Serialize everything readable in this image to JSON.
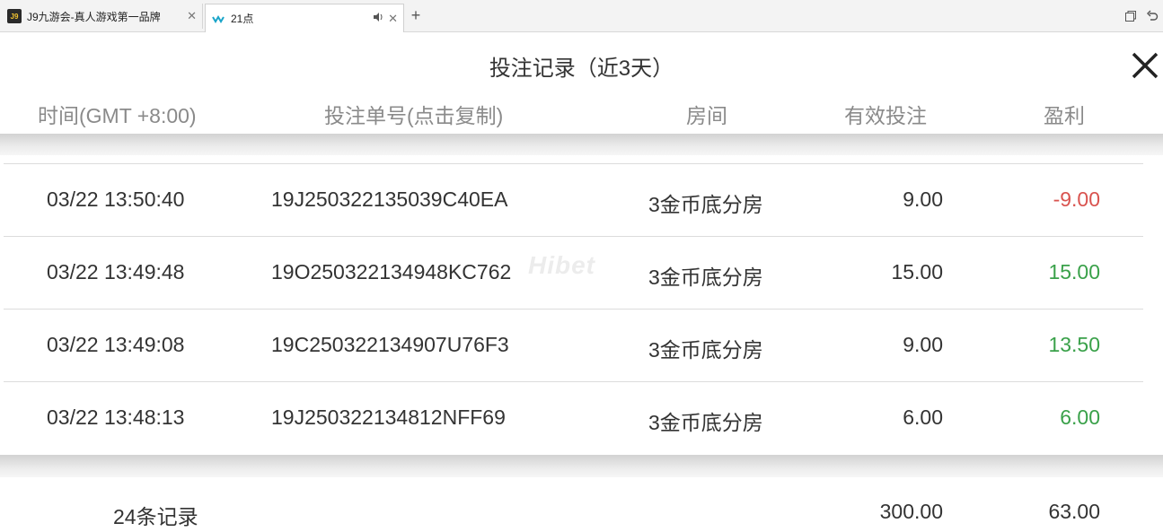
{
  "browser": {
    "tabs": [
      {
        "label": "J9九游会-真人游戏第一品牌",
        "favicon": "J9"
      },
      {
        "label": "21点"
      }
    ]
  },
  "dialog": {
    "title": "投注记录（近3天）",
    "columns": [
      "时间(GMT +8:00)",
      "投注单号(点击复制)",
      "房间",
      "有效投注",
      "盈利"
    ],
    "rows": [
      {
        "time": "03/22  13:50:40",
        "order": "19J250322135039C40EA",
        "room": "3金币底分房",
        "bet": "9.00",
        "profit": "-9.00"
      },
      {
        "time": "03/22  13:49:48",
        "order": "19O250322134948KC762",
        "room": "3金币底分房",
        "bet": "15.00",
        "profit": "15.00"
      },
      {
        "time": "03/22  13:49:08",
        "order": "19C250322134907U76F3",
        "room": "3金币底分房",
        "bet": "9.00",
        "profit": "13.50"
      },
      {
        "time": "03/22  13:48:13",
        "order": "19J250322134812NFF69",
        "room": "3金币底分房",
        "bet": "6.00",
        "profit": "6.00"
      }
    ],
    "footer": {
      "count": "24条记录",
      "total_bet": "300.00",
      "total_profit": "63.00"
    },
    "watermark": "Hibet"
  },
  "colors": {
    "negative": "#d9534f",
    "positive": "#3aa14a",
    "header_text": "#8a8a8a"
  }
}
